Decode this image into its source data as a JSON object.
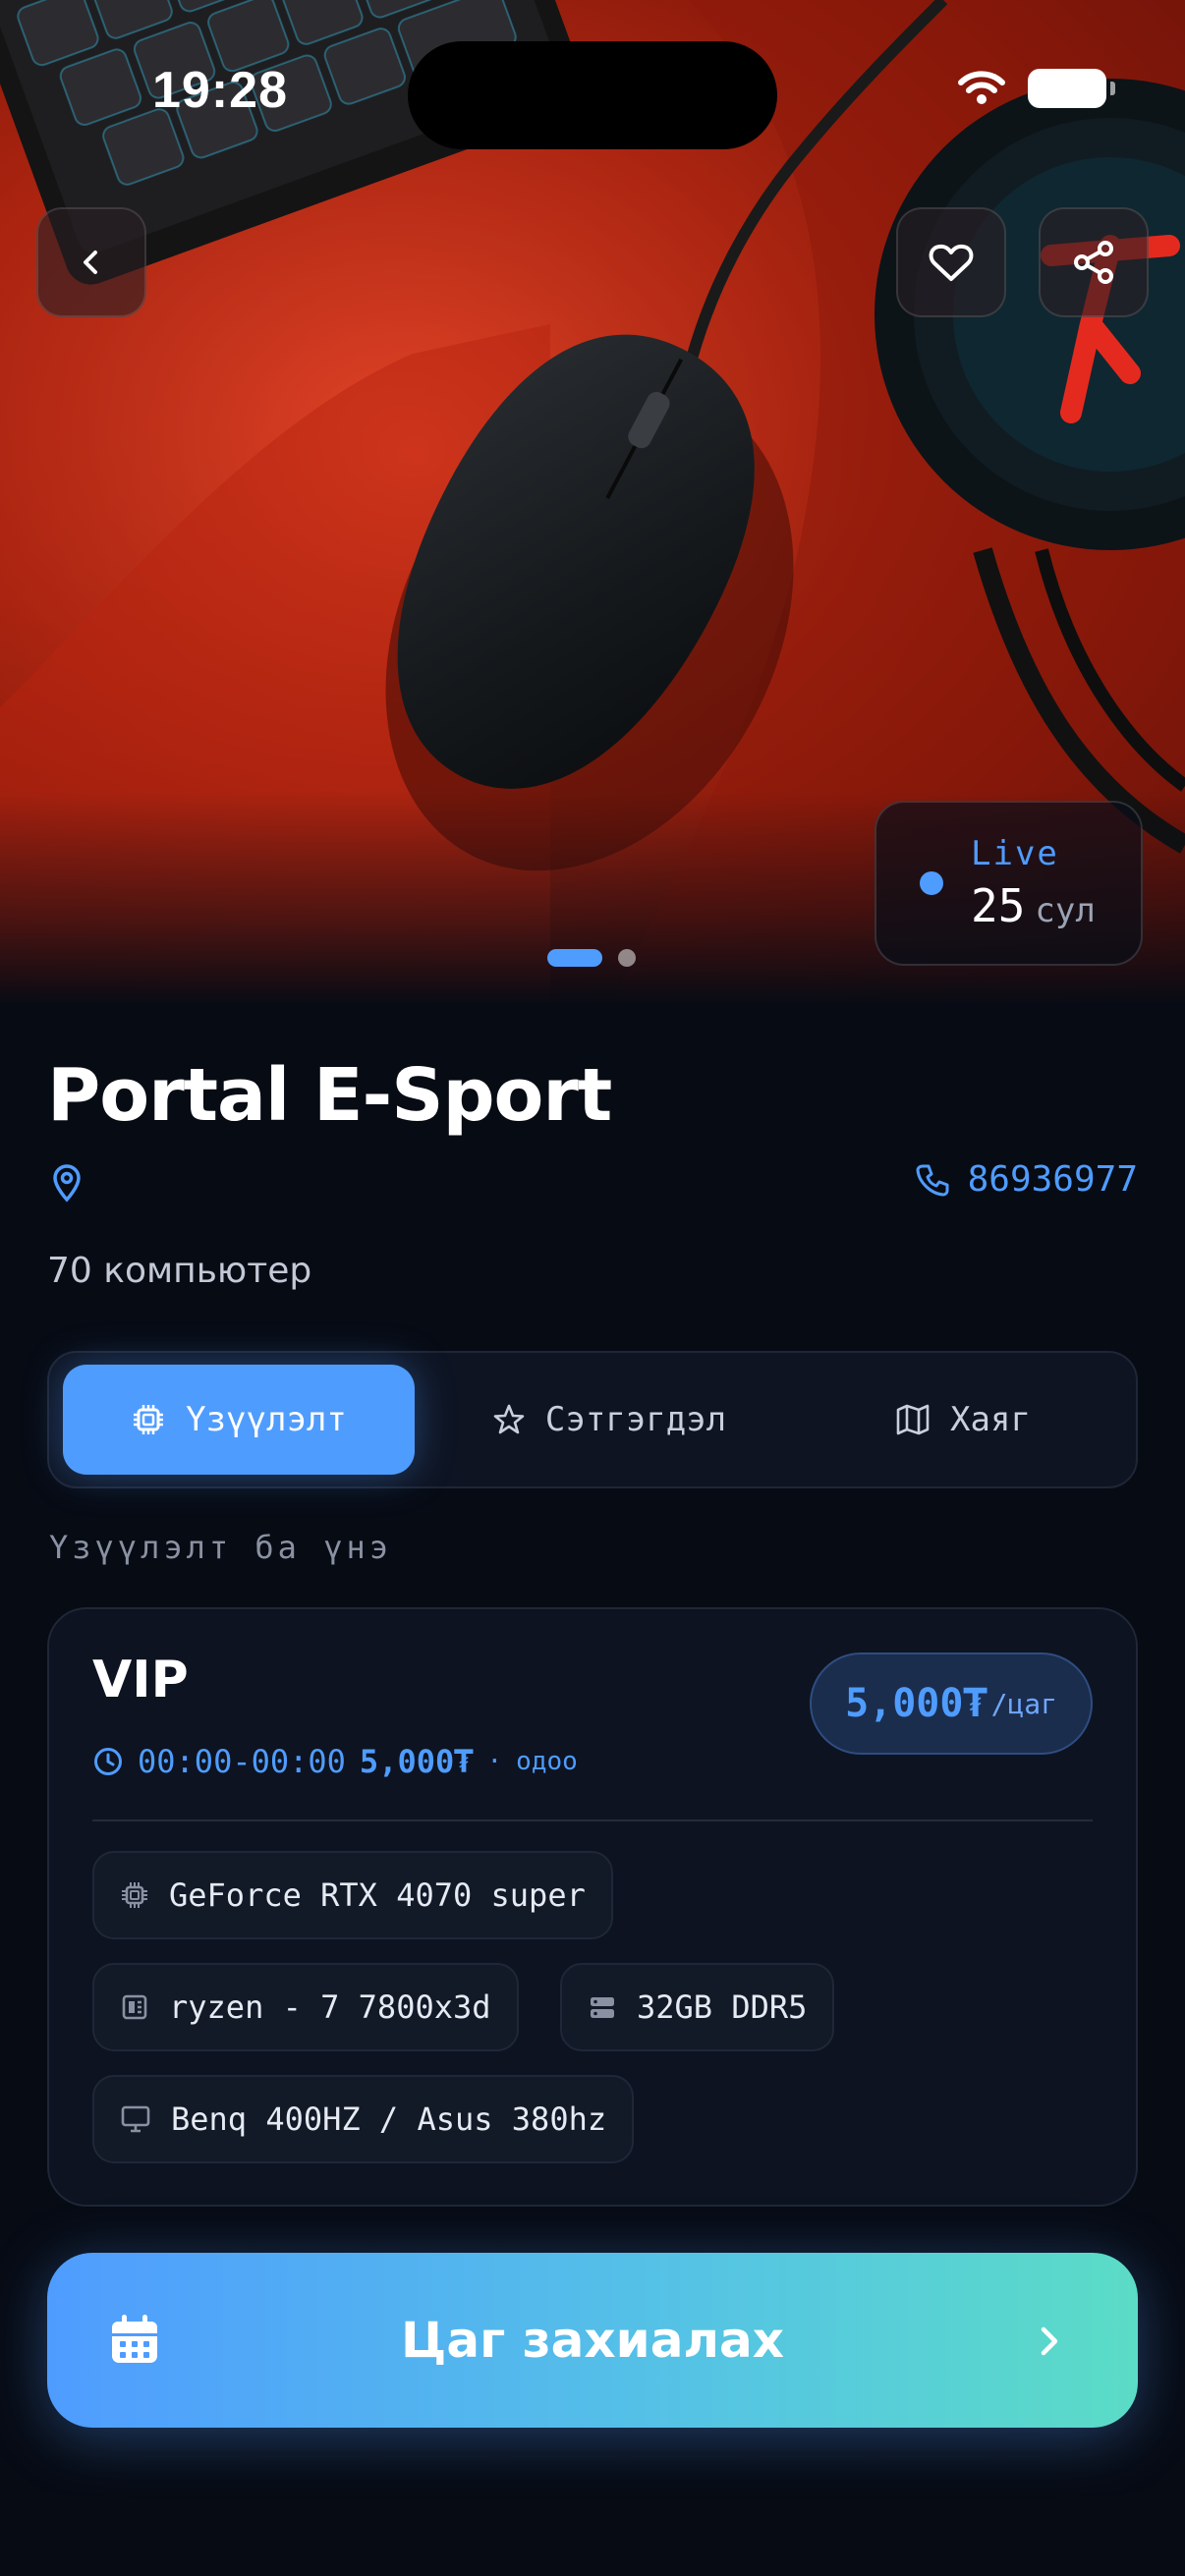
{
  "status_bar": {
    "time": "19:28"
  },
  "hero": {
    "live": {
      "label": "Live",
      "value": "25",
      "unit": "сул"
    },
    "pager": {
      "pages": 2,
      "active": 1
    }
  },
  "venue": {
    "title": "Portal E-Sport",
    "phone": "86936977",
    "pc_count": "70 компьютер"
  },
  "tabs": [
    {
      "label": "Үзүүлэлт",
      "icon": "chip-icon",
      "active": true
    },
    {
      "label": "Сэтгэгдэл",
      "icon": "star-icon",
      "active": false
    },
    {
      "label": "Хаяг",
      "icon": "map-icon",
      "active": false
    }
  ],
  "section_label": "Үзүүлэлт ба үнэ",
  "plan": {
    "name": "VIP",
    "hours": "00:00-00:00",
    "price_inline": "5,000₮",
    "separator": "·",
    "now": "одоо",
    "price_amount": "5,000₮",
    "price_unit": "/цаг",
    "specs": {
      "gpu": "GeForce RTX 4070 super",
      "cpu": "ryzen - 7 7800x3d",
      "ram": "32GB DDR5",
      "monitor": "Benq 400HZ / Asus 380hz"
    }
  },
  "cta": {
    "label": "Цаг захиалах"
  },
  "colors": {
    "accent": "#4f9cff",
    "background": "#070b14",
    "card": "#0d1320",
    "cta_gradient_end": "#5bdcc6"
  }
}
